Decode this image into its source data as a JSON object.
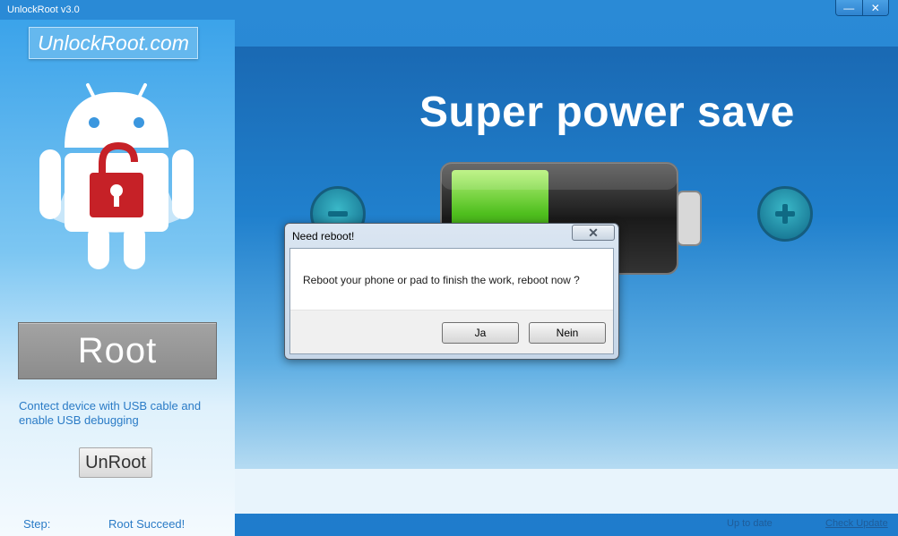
{
  "window": {
    "title": "UnlockRoot v3.0",
    "minimize_glyph": "—",
    "close_glyph": "✕"
  },
  "sidebar": {
    "brand": "UnlockRoot.com",
    "root_label": "Root",
    "hint": "Contect device with USB cable and enable USB debugging",
    "unroot_label": "UnRoot"
  },
  "main": {
    "headline": "Super power save",
    "minus_icon": "minus-circle-icon",
    "plus_icon": "plus-circle-icon",
    "battery_icon": "battery-icon",
    "battery_level": 0.45
  },
  "status": {
    "step_label": "Step:",
    "step_value": "Root Succeed!",
    "update_status": "Up to date",
    "check_update": "Check Update"
  },
  "dialog": {
    "title": "Need reboot!",
    "message": "Reboot your phone or pad to finish the work, reboot now ?",
    "yes_label": "Ja",
    "no_label": "Nein",
    "close_glyph": "✕"
  },
  "colors": {
    "accent": "#2a7bc6",
    "brand_bg": "#65b8ee",
    "lock": "#c62127"
  }
}
